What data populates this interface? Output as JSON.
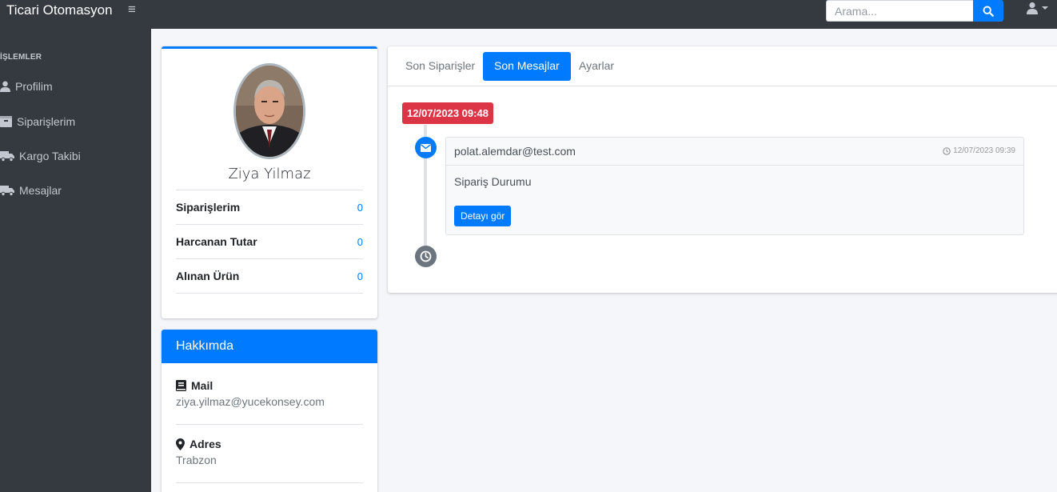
{
  "navbar": {
    "brand": "Ticari Otomasyon",
    "search_placeholder": "Arama..."
  },
  "sidebar": {
    "header": "İŞLEMLER",
    "items": [
      {
        "label": "Profilim",
        "icon": "user-icon"
      },
      {
        "label": "Siparişlerim",
        "icon": "box-icon"
      },
      {
        "label": "Kargo Takibi",
        "icon": "truck-icon"
      },
      {
        "label": "Mesajlar",
        "icon": "truck-icon"
      }
    ]
  },
  "profile": {
    "name": "Ziya Yilmaz",
    "stats": [
      {
        "label": "Siparişlerim",
        "value": "0"
      },
      {
        "label": "Harcanan Tutar",
        "value": "0"
      },
      {
        "label": "Alınan Ürün",
        "value": "0"
      }
    ]
  },
  "about": {
    "title": "Hakkımda",
    "mail_label": "Mail",
    "mail_value": "ziya.yilmaz@yucekonsey.com",
    "address_label": "Adres",
    "address_value": "Trabzon"
  },
  "tabs": [
    {
      "label": "Son Siparişler",
      "active": false
    },
    {
      "label": "Son Mesajlar",
      "active": true
    },
    {
      "label": "Ayarlar",
      "active": false
    }
  ],
  "timeline": {
    "date_label": "12/07/2023 09:48",
    "item": {
      "sender": "polat.alemdar@test.com",
      "time": "12/07/2023 09:39",
      "body": "Sipariş Durumu",
      "button": "Detayı gör"
    }
  },
  "colors": {
    "primary": "#007bff",
    "danger": "#dc3545",
    "dark": "#343a40",
    "secondary": "#6c757d"
  }
}
